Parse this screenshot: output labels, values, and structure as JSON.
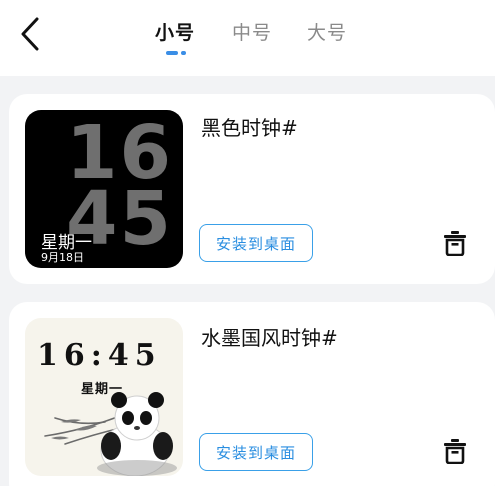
{
  "header": {
    "back_icon": "chevron-left-icon",
    "tabs": [
      {
        "label": "小号",
        "active": true
      },
      {
        "label": "中号",
        "active": false
      },
      {
        "label": "大号",
        "active": false
      }
    ],
    "accent_color": "#3a8ee6"
  },
  "widgets": [
    {
      "title": "黑色时钟#",
      "preview": {
        "hour": "16",
        "minute": "45",
        "weekday": "星期一",
        "date": "9月18日"
      },
      "install_label": "安装到桌面",
      "delete_icon": "trash-icon"
    },
    {
      "title": "水墨国风时钟#",
      "preview": {
        "time": "16:45",
        "weekday": "星期一"
      },
      "install_label": "安装到桌面",
      "delete_icon": "trash-icon"
    }
  ]
}
